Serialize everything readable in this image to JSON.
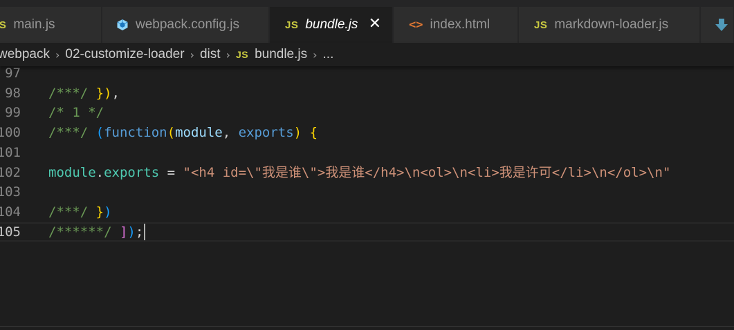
{
  "tabs": [
    {
      "label": "main.js",
      "icon": "js-icon",
      "icon_text": "JS"
    },
    {
      "label": "webpack.config.js",
      "icon": "webpack-icon"
    },
    {
      "label": "bundle.js",
      "icon": "js-icon",
      "icon_text": "JS",
      "active": true
    },
    {
      "label": "index.html",
      "icon": "html-icon",
      "icon_text": "<>"
    },
    {
      "label": "markdown-loader.js",
      "icon": "js-icon",
      "icon_text": "JS"
    }
  ],
  "tab_close": "✕",
  "breadcrumb": {
    "items": [
      "webpack",
      "02-customize-loader",
      "dist",
      "bundle.js",
      "..."
    ],
    "file_icon_text": "JS",
    "separator": "›"
  },
  "lines": [
    {
      "num": "97",
      "tokens": []
    },
    {
      "num": "98",
      "tokens": [
        {
          "t": "/***/ ",
          "c": "comment"
        },
        {
          "t": "}",
          "c": "brace"
        },
        {
          "t": ")",
          "c": "brace"
        },
        {
          "t": ",",
          "c": "punct"
        }
      ]
    },
    {
      "num": "99",
      "tokens": [
        {
          "t": "/* 1 */",
          "c": "comment"
        }
      ]
    },
    {
      "num": "100",
      "tokens": [
        {
          "t": "/***/ ",
          "c": "comment"
        },
        {
          "t": "(",
          "c": "brace3"
        },
        {
          "t": "function",
          "c": "keyword"
        },
        {
          "t": "(",
          "c": "brace"
        },
        {
          "t": "module",
          "c": "param"
        },
        {
          "t": ", ",
          "c": "punct"
        },
        {
          "t": "exports",
          "c": "keyword"
        },
        {
          "t": ") ",
          "c": "brace"
        },
        {
          "t": "{",
          "c": "brace"
        }
      ]
    },
    {
      "num": "101",
      "tokens": []
    },
    {
      "num": "102",
      "tokens": [
        {
          "t": "module",
          "c": "var"
        },
        {
          "t": ".",
          "c": "punct"
        },
        {
          "t": "exports",
          "c": "var"
        },
        {
          "t": " = ",
          "c": "punct"
        },
        {
          "t": "\"<h4 id=",
          "c": "string"
        },
        {
          "t": "\\\"",
          "c": "string"
        },
        {
          "t": "我是谁",
          "c": "string"
        },
        {
          "t": "\\\"",
          "c": "string"
        },
        {
          "t": ">我是谁</h4>",
          "c": "string"
        },
        {
          "t": "\\n",
          "c": "string"
        },
        {
          "t": "<ol>",
          "c": "string"
        },
        {
          "t": "\\n",
          "c": "string"
        },
        {
          "t": "<li>我是许可</li>",
          "c": "string"
        },
        {
          "t": "\\n",
          "c": "string"
        },
        {
          "t": "</ol>",
          "c": "string"
        },
        {
          "t": "\\n",
          "c": "string"
        },
        {
          "t": "\"",
          "c": "string"
        }
      ]
    },
    {
      "num": "103",
      "tokens": []
    },
    {
      "num": "104",
      "tokens": [
        {
          "t": "/***/ ",
          "c": "comment"
        },
        {
          "t": "}",
          "c": "brace"
        },
        {
          "t": ")",
          "c": "brace3"
        }
      ]
    },
    {
      "num": "105",
      "current": true,
      "tokens": [
        {
          "t": "/******/ ",
          "c": "comment"
        },
        {
          "t": "]",
          "c": "brace2"
        },
        {
          "t": ")",
          "c": "brace3"
        },
        {
          "t": ";",
          "c": "punct"
        }
      ]
    }
  ]
}
